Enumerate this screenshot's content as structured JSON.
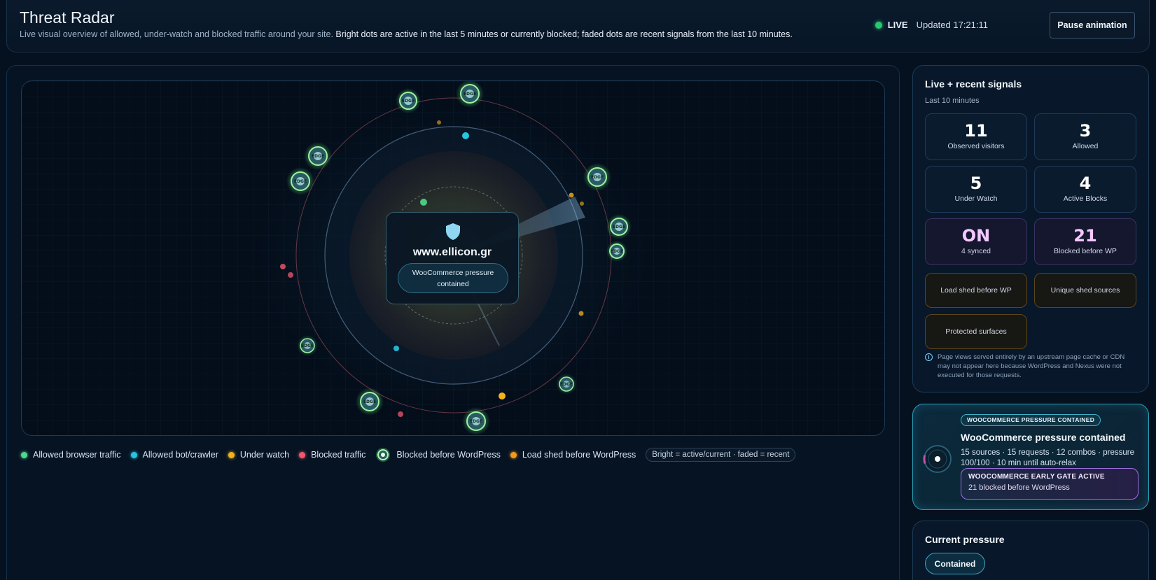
{
  "header": {
    "title": "Threat Radar",
    "subtitle_plain": "Live visual overview of allowed, under-watch and blocked traffic around your site.",
    "subtitle_emphasis": "Bright dots are active in the last 5 minutes or currently blocked; faded dots are recent signals from the last 10 minutes.",
    "live_label": "LIVE",
    "updated_text": "Updated 17:21:11",
    "pause_button": "Pause animation"
  },
  "radar": {
    "site_name": "www.ellicon.gr",
    "site_badge": "WooCommerce pressure contained",
    "edge_label": "EDGE"
  },
  "legend": {
    "items": [
      {
        "label": "Allowed browser traffic",
        "color": "#4fd98c"
      },
      {
        "label": "Allowed bot/crawler",
        "color": "#27c6e0"
      },
      {
        "label": "Under watch",
        "color": "#f2b21b"
      },
      {
        "label": "Blocked traffic",
        "color": "#f2576d"
      },
      {
        "label": "Blocked before WordPress",
        "color": "#86f29c"
      },
      {
        "label": "Load shed before WordPress",
        "color": "#f29a1b"
      }
    ],
    "note": "Bright = active/current · faded = recent"
  },
  "signals": {
    "title": "Live + recent signals",
    "subtitle": "Last 10 minutes",
    "stats": [
      {
        "value": "11",
        "label": "Observed visitors"
      },
      {
        "value": "3",
        "label": "Allowed"
      },
      {
        "value": "5",
        "label": "Under Watch"
      },
      {
        "value": "4",
        "label": "Active Blocks"
      },
      {
        "value": "ON",
        "label": "4 synced"
      },
      {
        "value": "21",
        "label": "Blocked before WP"
      }
    ],
    "amber_stats": [
      "Load shed before WP",
      "Unique shed sources",
      "Protected surfaces"
    ],
    "info_icon": "info-icon",
    "info": "Page views served entirely by an upstream page cache or CDN may not appear here because WordPress and Nexus were not executed for those requests."
  },
  "woocommerce": {
    "pill": "WOOCOMMERCE PRESSURE CONTAINED",
    "title": "WooCommerce pressure contained",
    "description": "15 sources · 15 requests · 12 combos · pressure 100/100 · 10 min until auto-relax",
    "gate_title": "WOOCOMMERCE EARLY GATE ACTIVE",
    "gate_sub": "21 blocked before WordPress",
    "pressure_level": 1.0
  },
  "pressure": {
    "title": "Current pressure",
    "status": "Contained"
  }
}
